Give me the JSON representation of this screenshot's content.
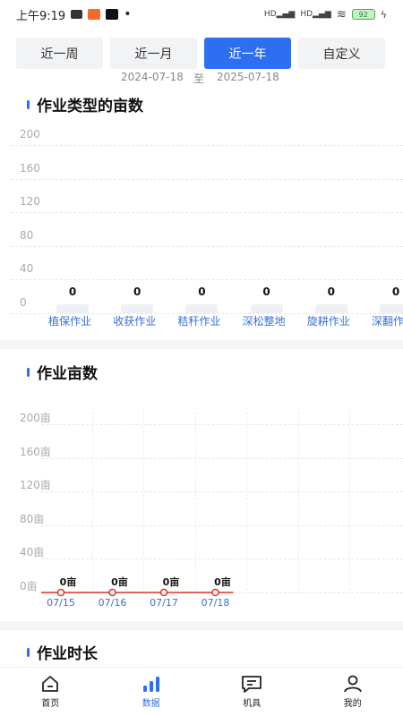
{
  "status_bar": {
    "time": "上午9:19",
    "battery": "92"
  },
  "range_tabs": [
    {
      "label": "近一周",
      "active": false
    },
    {
      "label": "近一月",
      "active": false
    },
    {
      "label": "近一年",
      "active": true
    },
    {
      "label": "自定义",
      "active": false
    }
  ],
  "date_range": {
    "start": "2024-07-18",
    "separator": "至",
    "end": "2025-07-18"
  },
  "sections": {
    "type_title": "作业类型的亩数",
    "acreage_title": "作业亩数",
    "duration_title": "作业时长"
  },
  "chart_data": [
    {
      "type": "bar",
      "title": "作业类型的亩数",
      "categories": [
        "植保作业",
        "收获作业",
        "秸秆作业",
        "深松整地",
        "旋耕作业",
        "深翻作"
      ],
      "values": [
        0,
        0,
        0,
        0,
        0,
        0
      ],
      "value_labels": [
        "0",
        "0",
        "0",
        "0",
        "0",
        "0"
      ],
      "ylim": [
        0,
        200
      ],
      "yticks": [
        "200",
        "160",
        "120",
        "80",
        "40",
        "0"
      ],
      "grid": true
    },
    {
      "type": "line",
      "title": "作业亩数",
      "x": [
        "07/15",
        "07/16",
        "07/17",
        "07/18"
      ],
      "values": [
        0,
        0,
        0,
        0
      ],
      "value_labels": [
        "0亩",
        "0亩",
        "0亩",
        "0亩"
      ],
      "ylim": [
        0,
        200
      ],
      "yticks": [
        "200亩",
        "160亩",
        "120亩",
        "80亩",
        "40亩",
        "0亩"
      ],
      "line_color": "#d9342b",
      "grid": true
    }
  ],
  "bottom_nav": [
    {
      "label": "首页",
      "icon": "home-icon",
      "active": false
    },
    {
      "label": "数据",
      "icon": "bar-chart-icon",
      "active": true
    },
    {
      "label": "机具",
      "icon": "message-icon",
      "active": false
    },
    {
      "label": "我的",
      "icon": "user-icon",
      "active": false
    }
  ]
}
